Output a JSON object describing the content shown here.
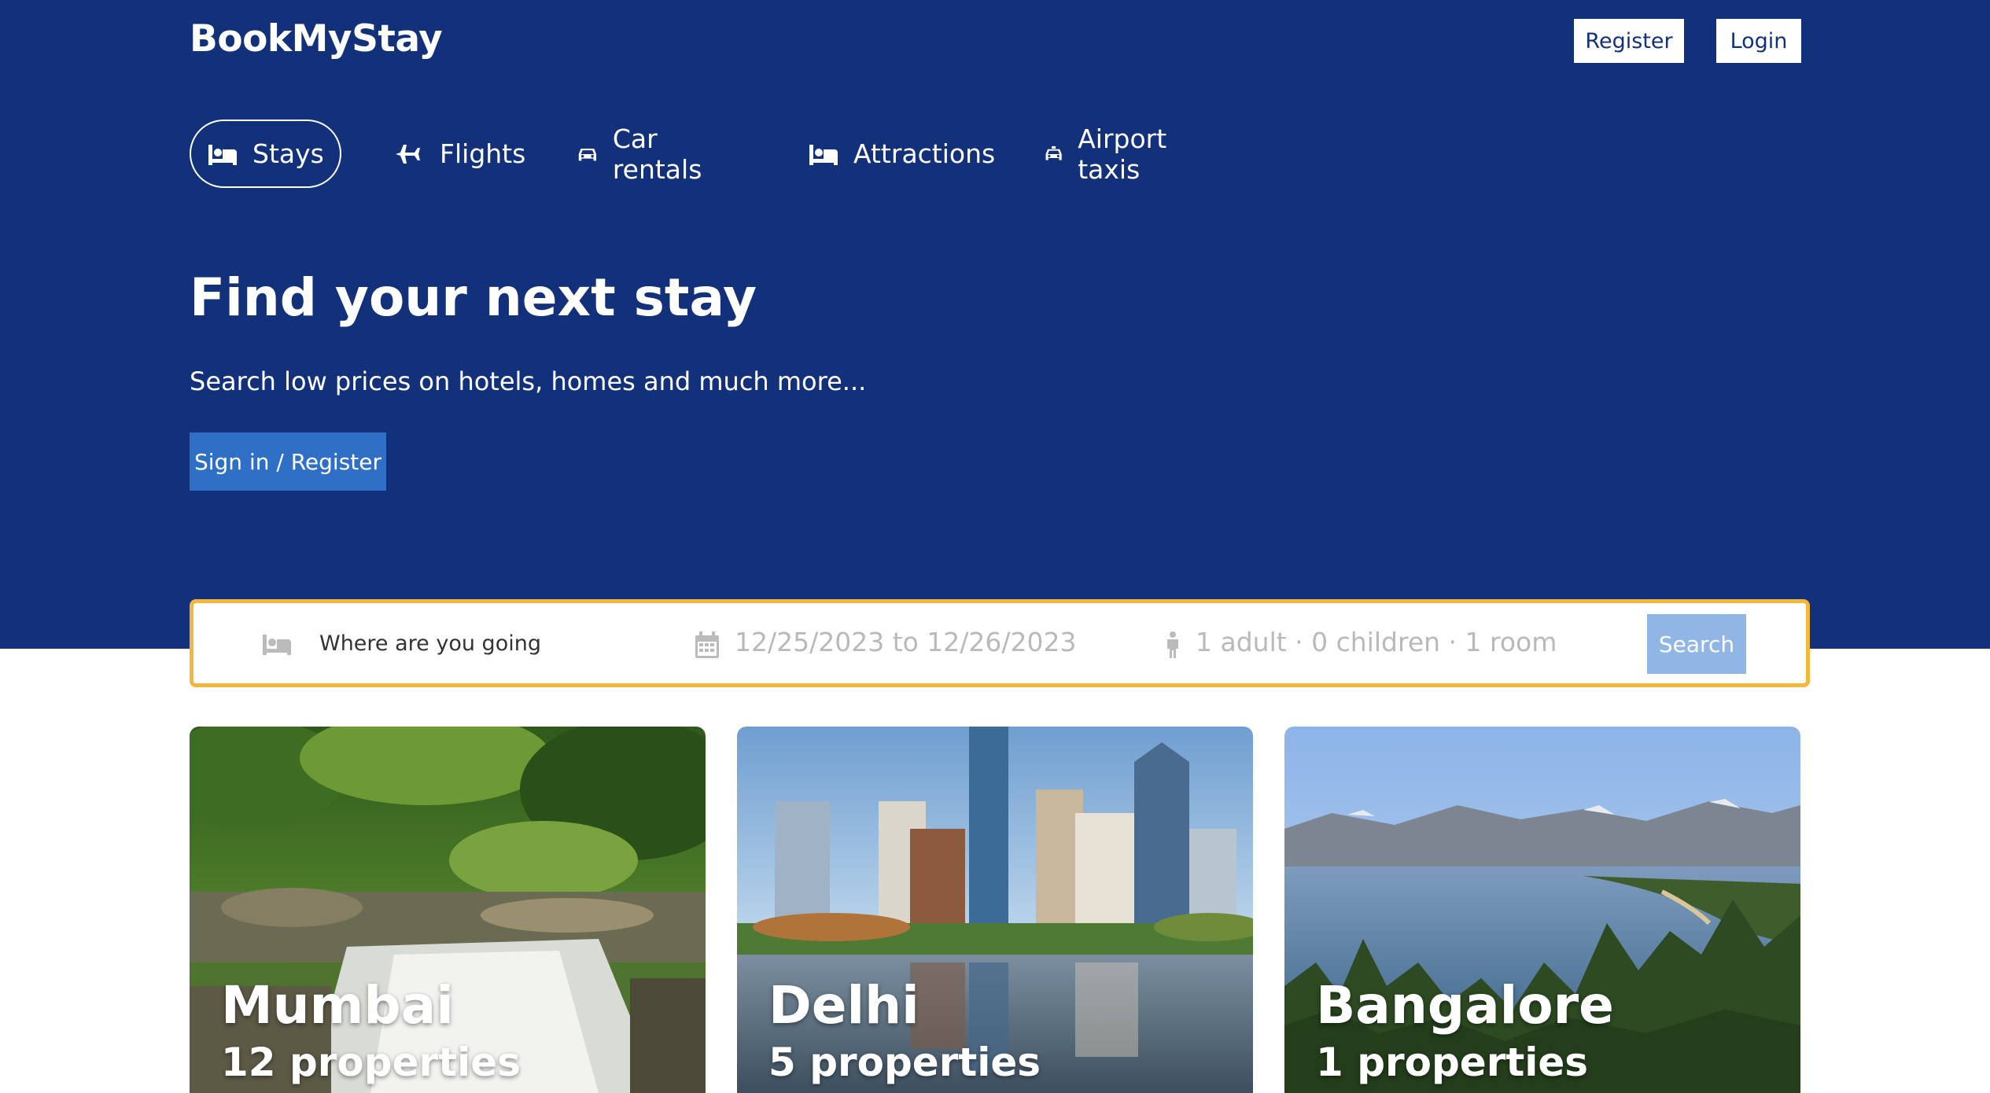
{
  "header": {
    "logo": "BookMyStay",
    "register_label": "Register",
    "login_label": "Login"
  },
  "nav": {
    "items": [
      {
        "label": "Stays",
        "icon": "bed-icon",
        "active": true
      },
      {
        "label": "Flights",
        "icon": "plane-icon",
        "active": false
      },
      {
        "label": "Car rentals",
        "icon": "car-icon",
        "active": false
      },
      {
        "label": "Attractions",
        "icon": "bed-icon",
        "active": false
      },
      {
        "label": "Airport taxis",
        "icon": "taxi-icon",
        "active": false
      }
    ]
  },
  "hero": {
    "title": "Find your next stay",
    "subtitle": "Search low prices on hotels, homes and much more...",
    "signin_label": "Sign in / Register"
  },
  "search": {
    "destination_placeholder": "Where are you going",
    "dates": "12/25/2023 to 12/26/2023",
    "guests": "1 adult · 0 children · 1 room",
    "search_label": "Search"
  },
  "cities": [
    {
      "name": "Mumbai",
      "count": "12 properties"
    },
    {
      "name": "Delhi",
      "count": "5 properties"
    },
    {
      "name": "Bangalore",
      "count": "1 properties"
    }
  ],
  "colors": {
    "hero_bg": "#13317b",
    "primary_button": "#2f6fc6",
    "search_border": "#f4b73a",
    "search_button": "#8fb6e4"
  }
}
